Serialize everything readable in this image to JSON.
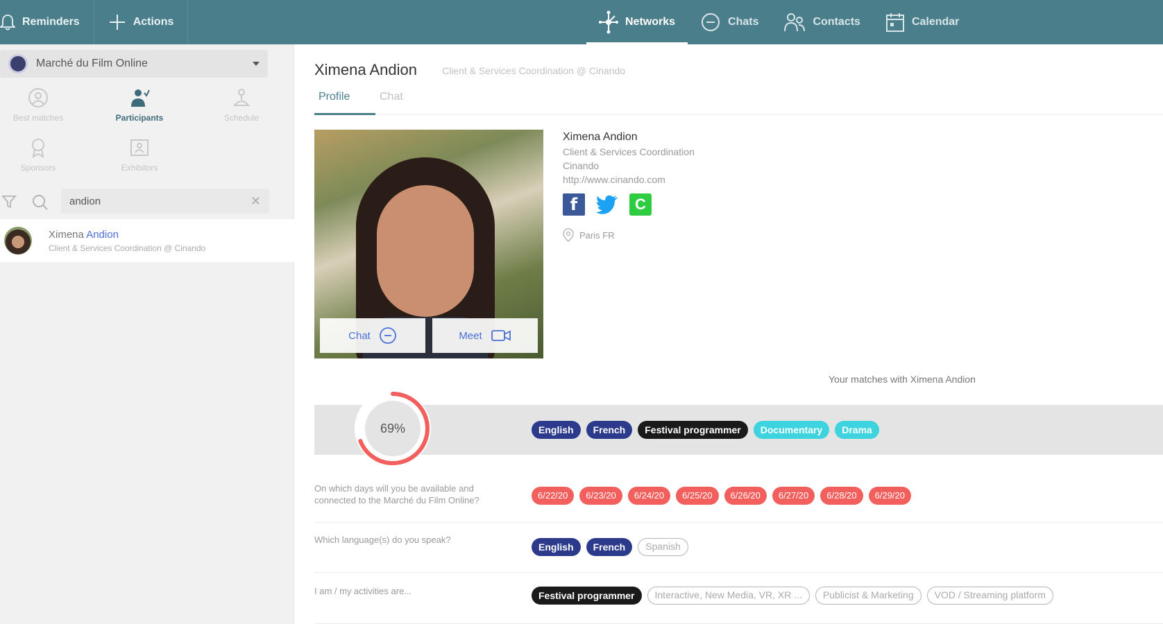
{
  "topbar": {
    "reminders": "Reminders",
    "actions": "Actions",
    "nav": [
      {
        "label": "Networks",
        "icon": "network-icon"
      },
      {
        "label": "Chats",
        "icon": "chat-icon"
      },
      {
        "label": "Contacts",
        "icon": "contacts-icon"
      },
      {
        "label": "Calendar",
        "icon": "calendar-icon"
      }
    ],
    "color": "#4a7e8a"
  },
  "sidebar": {
    "event": "Marché du Film Online",
    "tabs": [
      "Best matches",
      "Participants",
      "Schedule",
      "Sponsors",
      "Exhibitors"
    ],
    "active_tab": "Participants",
    "search_value": "andion",
    "result": {
      "name_prefix": "Ximena ",
      "name_highlight": "Andion",
      "subtitle": "Client & Services Coordination @ Cinando"
    }
  },
  "profile": {
    "name": "Ximena Andion",
    "subtitle": "Client & Services Coordination @ Cinando",
    "tabs": [
      "Profile",
      "Chat"
    ],
    "photo_actions": {
      "chat": "Chat",
      "meet": "Meet"
    },
    "info": {
      "name": "Ximena Andion",
      "role": "Client & Services Coordination",
      "company": "Cinando",
      "url": "http://www.cinando.com",
      "location": "Paris FR"
    }
  },
  "matches": {
    "title": "Your matches with Ximena Andion",
    "score": "69%",
    "score_fraction": 0.69,
    "chips": [
      {
        "label": "English",
        "style": "navy"
      },
      {
        "label": "French",
        "style": "navy"
      },
      {
        "label": "Festival programmer",
        "style": "black"
      },
      {
        "label": "Documentary",
        "style": "cyan"
      },
      {
        "label": "Drama",
        "style": "cyan"
      }
    ]
  },
  "questions": [
    {
      "text": "On which days will you be available and connected to the Marché du Film Online?",
      "chips": [
        {
          "label": "6/22/20",
          "style": "red"
        },
        {
          "label": "6/23/20",
          "style": "red"
        },
        {
          "label": "6/24/20",
          "style": "red"
        },
        {
          "label": "6/25/20",
          "style": "red"
        },
        {
          "label": "6/26/20",
          "style": "red"
        },
        {
          "label": "6/27/20",
          "style": "red"
        },
        {
          "label": "6/28/20",
          "style": "red"
        },
        {
          "label": "6/29/20",
          "style": "red"
        }
      ]
    },
    {
      "text": "Which language(s) do you speak?",
      "chips": [
        {
          "label": "English",
          "style": "navy"
        },
        {
          "label": "French",
          "style": "navy"
        },
        {
          "label": "Spanish",
          "style": "outline"
        }
      ]
    },
    {
      "text": "I am / my activities are...",
      "chips": [
        {
          "label": "Festival programmer",
          "style": "black"
        },
        {
          "label": "Interactive, New Media, VR, XR ...",
          "style": "outline"
        },
        {
          "label": "Publicist & Marketing",
          "style": "outline"
        },
        {
          "label": "VOD / Streaming platform",
          "style": "outline"
        }
      ]
    }
  ]
}
